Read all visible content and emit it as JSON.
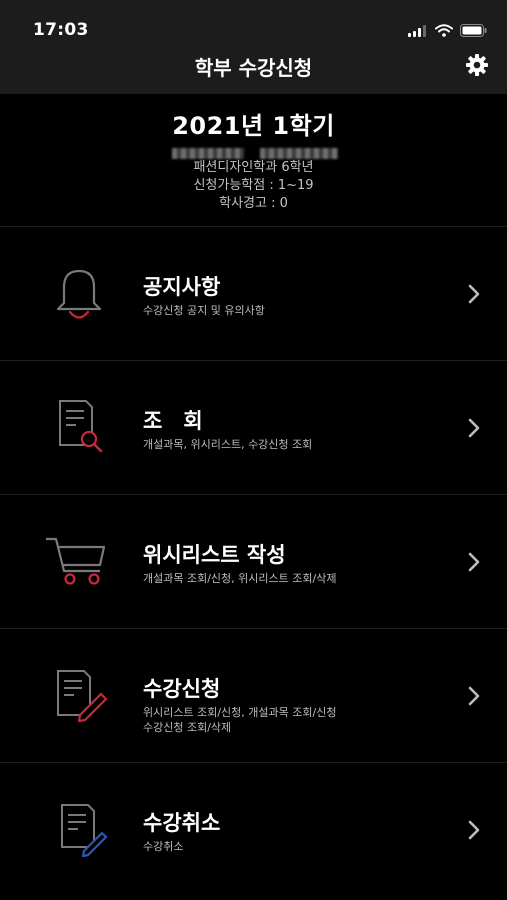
{
  "status_bar": {
    "time": "17:03"
  },
  "header": {
    "title": "학부 수강신청",
    "settings_icon": "gear-icon"
  },
  "student": {
    "term": "2021년 1학기",
    "department_year": "패션디자인학과 6학년",
    "credits": "신청가능학점 : 1~19",
    "warning": "학사경고 : 0"
  },
  "menu": {
    "items": [
      {
        "title": "공지사항",
        "desc": "수강신청 공지 및 유의사항",
        "icon": "bell-icon"
      },
      {
        "title": "조　회",
        "desc": "개설과목, 위시리스트, 수강신청 조회",
        "icon": "document-search-icon"
      },
      {
        "title": "위시리스트 작성",
        "desc": "개설과목 조회/신청, 위시리스트 조회/삭제",
        "icon": "cart-icon"
      },
      {
        "title": "수강신청",
        "desc": "위시리스트 조회/신청, 개설과목 조회/신청",
        "desc2": "수강신청 조회/삭제",
        "icon": "document-edit-icon"
      },
      {
        "title": "수강취소",
        "desc": "수강취소",
        "icon": "document-cancel-icon"
      }
    ]
  },
  "colors": {
    "accent": "#c8283c",
    "cancel_accent": "#2b57b8",
    "background": "#000000",
    "bar": "#1c1c1c"
  }
}
